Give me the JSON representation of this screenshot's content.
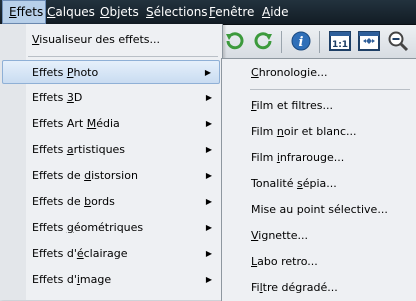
{
  "menubar": {
    "items": [
      {
        "pre": "",
        "ul": "E",
        "post": "ffets"
      },
      {
        "pre": "",
        "ul": "C",
        "post": "alques"
      },
      {
        "pre": "",
        "ul": "O",
        "post": "bjets"
      },
      {
        "pre": "",
        "ul": "S",
        "post": "élections"
      },
      {
        "pre": "",
        "ul": "F",
        "post": "enêtre"
      },
      {
        "pre": "",
        "ul": "A",
        "post": "ide"
      }
    ]
  },
  "menu": {
    "items": [
      {
        "pre": "",
        "ul": "V",
        "post": "isualiseur des effets..."
      },
      {
        "pre": "Effets ",
        "ul": "P",
        "post": "hoto"
      },
      {
        "pre": "Effets ",
        "ul": "3",
        "post": "D"
      },
      {
        "pre": "Effets Art ",
        "ul": "M",
        "post": "édia"
      },
      {
        "pre": "Effets ",
        "ul": "a",
        "post": "rtistiques"
      },
      {
        "pre": "Effets de ",
        "ul": "d",
        "post": "istorsion"
      },
      {
        "pre": "Effets de ",
        "ul": "b",
        "post": "ords"
      },
      {
        "pre": "Effets ",
        "ul": "g",
        "post": "éométriques"
      },
      {
        "pre": "Effets d'",
        "ul": "é",
        "post": "clairage"
      },
      {
        "pre": "Effets d'",
        "ul": "i",
        "post": "mage"
      }
    ]
  },
  "submenu": {
    "items": [
      {
        "pre": "",
        "ul": "C",
        "post": "hronologie..."
      },
      {
        "pre": "",
        "ul": "F",
        "post": "ilm et filtres..."
      },
      {
        "pre": "Film ",
        "ul": "n",
        "post": "oir et blanc..."
      },
      {
        "pre": "Film ",
        "ul": "i",
        "post": "nfrarouge..."
      },
      {
        "pre": "Tonalité ",
        "ul": "s",
        "post": "épia..."
      },
      {
        "pre": "Mise au point sélective",
        "ul": "",
        "post": "..."
      },
      {
        "pre": "",
        "ul": "V",
        "post": "ignette..."
      },
      {
        "pre": "",
        "ul": "L",
        "post": "abo retro..."
      },
      {
        "pre": "Fi",
        "ul": "l",
        "post": "tre dégradé..."
      }
    ]
  },
  "toolbar": {
    "icons": [
      "undo-icon",
      "redo-icon",
      "info-icon",
      "actual-size-icon",
      "fit-window-icon",
      "zoom-out-icon"
    ]
  },
  "colors": {
    "menubar_bg": "#1a2731",
    "highlight_bg": "#c9dcf1",
    "menu_bg": "#eef0f3"
  }
}
